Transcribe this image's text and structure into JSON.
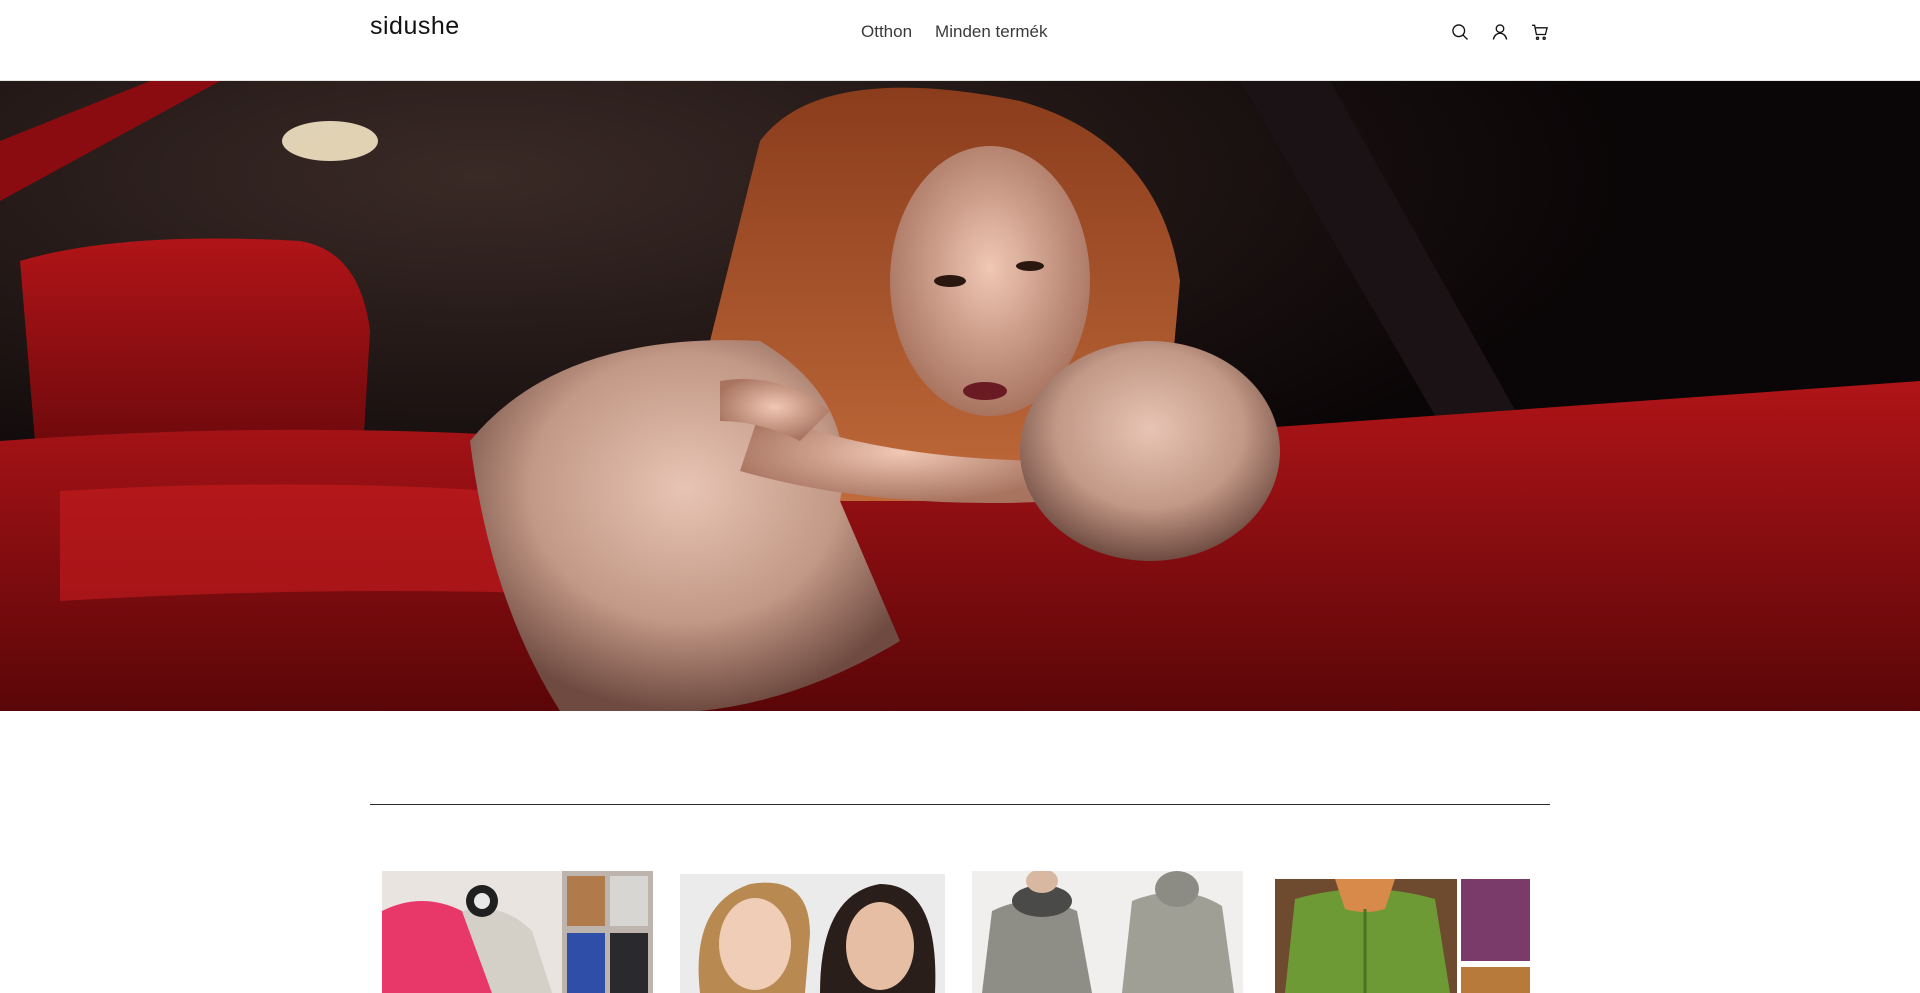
{
  "header": {
    "logo": "sidushe",
    "nav": [
      "Otthon",
      "Minden termék"
    ],
    "icons": [
      "search-icon",
      "account-icon",
      "cart-icon"
    ]
  },
  "hero": {
    "image": "woman-in-fur-coat-red-car-photo"
  },
  "products": {
    "items": [
      {
        "image": "pink-fluffy-cardigan-photo"
      },
      {
        "image": "two-women-portrait-photo"
      },
      {
        "image": "gray-hooded-coat-photo"
      },
      {
        "image": "green-hooded-cardigan-photo"
      }
    ]
  },
  "colors": {
    "text": "#121212",
    "nav_text": "#3a3a3a",
    "background": "#ffffff",
    "divider": "#2a2a2a"
  }
}
